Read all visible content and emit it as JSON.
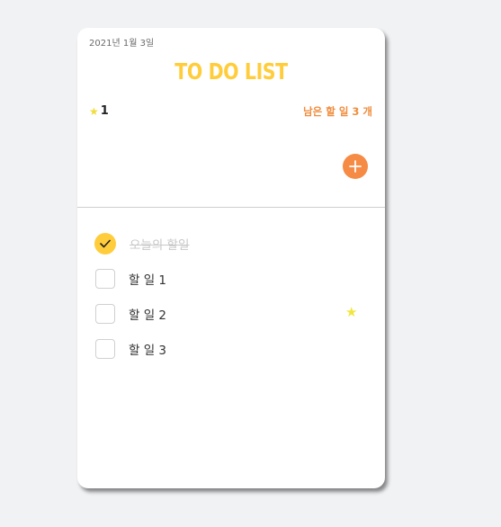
{
  "header": {
    "date": "2021년 1월 3일",
    "title": "TO DO LIST",
    "star_count": "1",
    "remaining": "남은 할 일 3 개"
  },
  "icons": {
    "star": "star-icon",
    "add": "plus-icon",
    "check": "checkmark-icon"
  },
  "colors": {
    "accent_yellow": "#ffcd3c",
    "accent_orange": "#f58b45",
    "star_yellow": "#f1e63e"
  },
  "todos": [
    {
      "text": "오늘의 할일",
      "done": true,
      "starred": false
    },
    {
      "text": "할 일 1",
      "done": false,
      "starred": false
    },
    {
      "text": "할 일 2",
      "done": false,
      "starred": true
    },
    {
      "text": "할 일 3",
      "done": false,
      "starred": false
    }
  ]
}
